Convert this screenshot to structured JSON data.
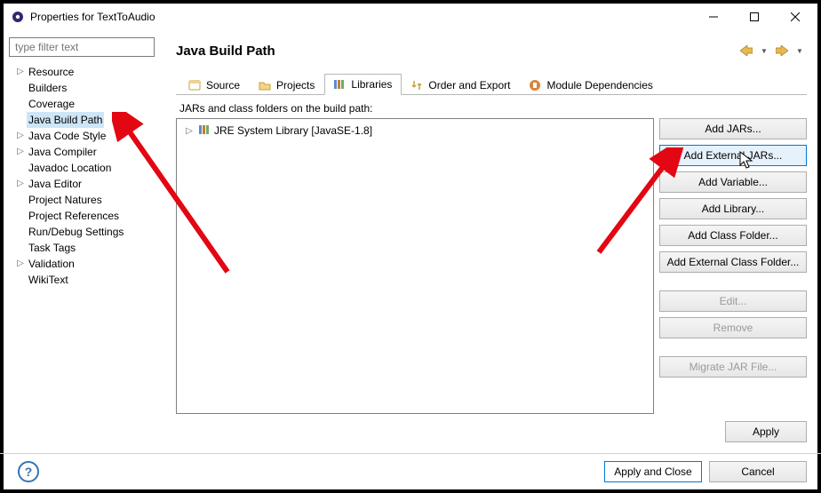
{
  "window": {
    "title": "Properties for TextToAudio"
  },
  "sidebar": {
    "filter_placeholder": "type filter text",
    "items": [
      {
        "label": "Resource",
        "expandable": true
      },
      {
        "label": "Builders",
        "expandable": false
      },
      {
        "label": "Coverage",
        "expandable": false
      },
      {
        "label": "Java Build Path",
        "expandable": false,
        "selected": true
      },
      {
        "label": "Java Code Style",
        "expandable": true
      },
      {
        "label": "Java Compiler",
        "expandable": true
      },
      {
        "label": "Javadoc Location",
        "expandable": false
      },
      {
        "label": "Java Editor",
        "expandable": true
      },
      {
        "label": "Project Natures",
        "expandable": false
      },
      {
        "label": "Project References",
        "expandable": false
      },
      {
        "label": "Run/Debug Settings",
        "expandable": false
      },
      {
        "label": "Task Tags",
        "expandable": false
      },
      {
        "label": "Validation",
        "expandable": true
      },
      {
        "label": "WikiText",
        "expandable": false
      }
    ]
  },
  "page": {
    "heading": "Java Build Path",
    "tabs": [
      {
        "label": "Source"
      },
      {
        "label": "Projects"
      },
      {
        "label": "Libraries",
        "active": true
      },
      {
        "label": "Order and Export"
      },
      {
        "label": "Module Dependencies"
      }
    ],
    "list_caption": "JARs and class folders on the build path:",
    "entries": [
      {
        "label": "JRE System Library [JavaSE-1.8]"
      }
    ]
  },
  "buttons": {
    "add_jars": "Add JARs...",
    "add_external_jars": "Add External JARs...",
    "add_variable": "Add Variable...",
    "add_library": "Add Library...",
    "add_class_folder": "Add Class Folder...",
    "add_ext_class_folder": "Add External Class Folder...",
    "edit": "Edit...",
    "remove": "Remove",
    "migrate": "Migrate JAR File...",
    "apply": "Apply",
    "apply_close": "Apply and Close",
    "cancel": "Cancel"
  }
}
